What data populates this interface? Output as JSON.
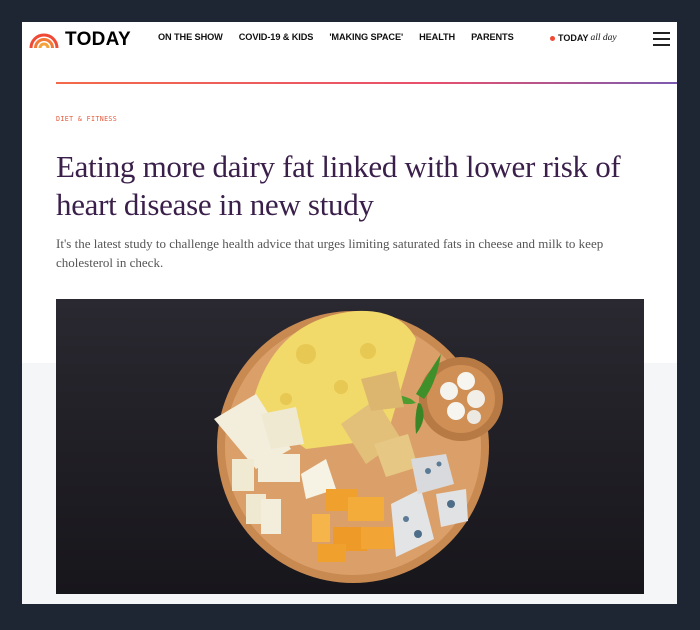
{
  "header": {
    "logo_text": "TODAY",
    "nav": [
      "ON THE SHOW",
      "COVID-19 & KIDS",
      "'MAKING SPACE'",
      "HEALTH",
      "PARENTS"
    ],
    "all_day_brand": "TODAY",
    "all_day_suffix": "all day",
    "logo_icon": "rainbow-icon",
    "menu_icon": "hamburger-menu-icon"
  },
  "article": {
    "eyebrow": "DIET & FITNESS",
    "headline": "Eating more dairy fat linked with lower risk of heart disease in new study",
    "dek": "It's the latest study to challenge health advice that urges limiting saturated fats in cheese and milk to keep cholesterol in check.",
    "hero_image": "cheese-board-photo"
  },
  "colors": {
    "accent": "#f04a36",
    "headline": "#3a1f4a",
    "background": "#1f2633"
  }
}
